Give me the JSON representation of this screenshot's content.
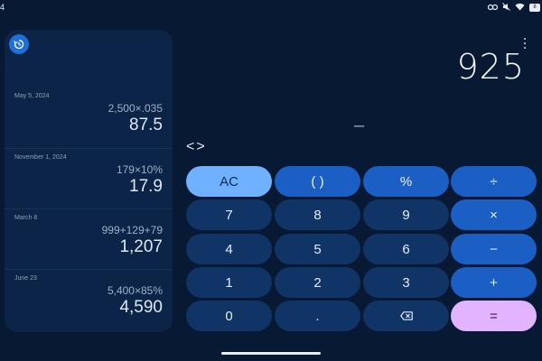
{
  "status": {
    "time": "4",
    "icons": [
      "link-icon",
      "mute-icon",
      "wifi-icon",
      "battery-icon"
    ],
    "battery_label": "8"
  },
  "history": {
    "toggle_icon": "history-icon",
    "entries": [
      {
        "date": "May 5, 2024",
        "expression": "2,500×.035",
        "result": "87.5"
      },
      {
        "date": "November 1, 2024",
        "expression": "179×10%",
        "result": "17.9"
      },
      {
        "date": "March 8",
        "expression": "999+129+79",
        "result": "1,207"
      },
      {
        "date": "June 23",
        "expression": "5,400×85%",
        "result": "4,590"
      }
    ]
  },
  "display": {
    "value": "925",
    "preview": "–",
    "cursor_arrows": "<>"
  },
  "keypad": {
    "rows": [
      [
        "AC",
        "( )",
        "%",
        "÷"
      ],
      [
        "7",
        "8",
        "9",
        "×"
      ],
      [
        "4",
        "5",
        "6",
        "−"
      ],
      [
        "1",
        "2",
        "3",
        "+"
      ],
      [
        "0",
        ".",
        "backspace",
        "="
      ]
    ]
  },
  "colors": {
    "background": "#081a33",
    "panel": "#0c2447",
    "number_key": "#0f3465",
    "operator_key": "#1b5fc4",
    "clear_key": "#6fb1ff",
    "equals_key": "#e2b4ff"
  }
}
